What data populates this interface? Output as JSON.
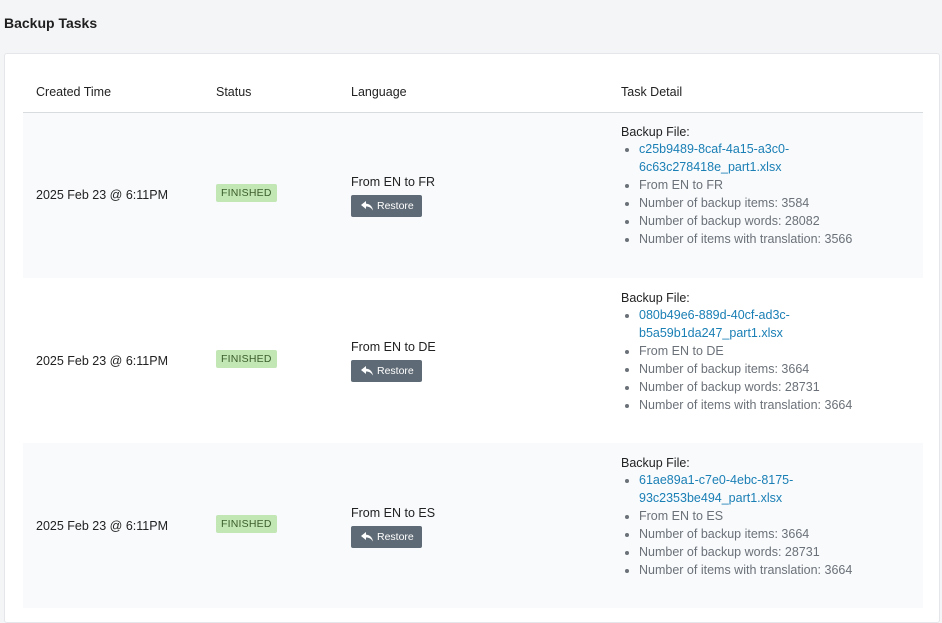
{
  "page": {
    "title": "Backup Tasks"
  },
  "table": {
    "headers": {
      "created_time": "Created Time",
      "status": "Status",
      "language": "Language",
      "task_detail": "Task Detail"
    },
    "restore_label": "Restore",
    "detail_title": "Backup File:",
    "rows": [
      {
        "created_time": "2025 Feb 23 @ 6:11PM",
        "status": "FINISHED",
        "language": "From EN to FR",
        "file_name": "c25b9489-8caf-4a15-a3c0-6c63c278418e_part1.xlsx",
        "direction": "From EN to FR",
        "backup_items": "Number of backup items: 3584",
        "backup_words": "Number of backup words: 28082",
        "items_with_translation": "Number of items with translation: 3566"
      },
      {
        "created_time": "2025 Feb 23 @ 6:11PM",
        "status": "FINISHED",
        "language": "From EN to DE",
        "file_name": "080b49e6-889d-40cf-ad3c-b5a59b1da247_part1.xlsx",
        "direction": "From EN to DE",
        "backup_items": "Number of backup items: 3664",
        "backup_words": "Number of backup words: 28731",
        "items_with_translation": "Number of items with translation: 3664"
      },
      {
        "created_time": "2025 Feb 23 @ 6:11PM",
        "status": "FINISHED",
        "language": "From EN to ES",
        "file_name": "61ae89a1-c7e0-4ebc-8175-93c2353be494_part1.xlsx",
        "direction": "From EN to ES",
        "backup_items": "Number of backup items: 3664",
        "backup_words": "Number of backup words: 28731",
        "items_with_translation": "Number of items with translation: 3664"
      }
    ]
  },
  "colors": {
    "badge_bg": "#c3e6b5",
    "badge_text": "#3a5d2a",
    "button_bg": "#5e6a75",
    "link": "#1a7fb5"
  },
  "icons": {
    "restore": "reply-arrow-icon"
  }
}
